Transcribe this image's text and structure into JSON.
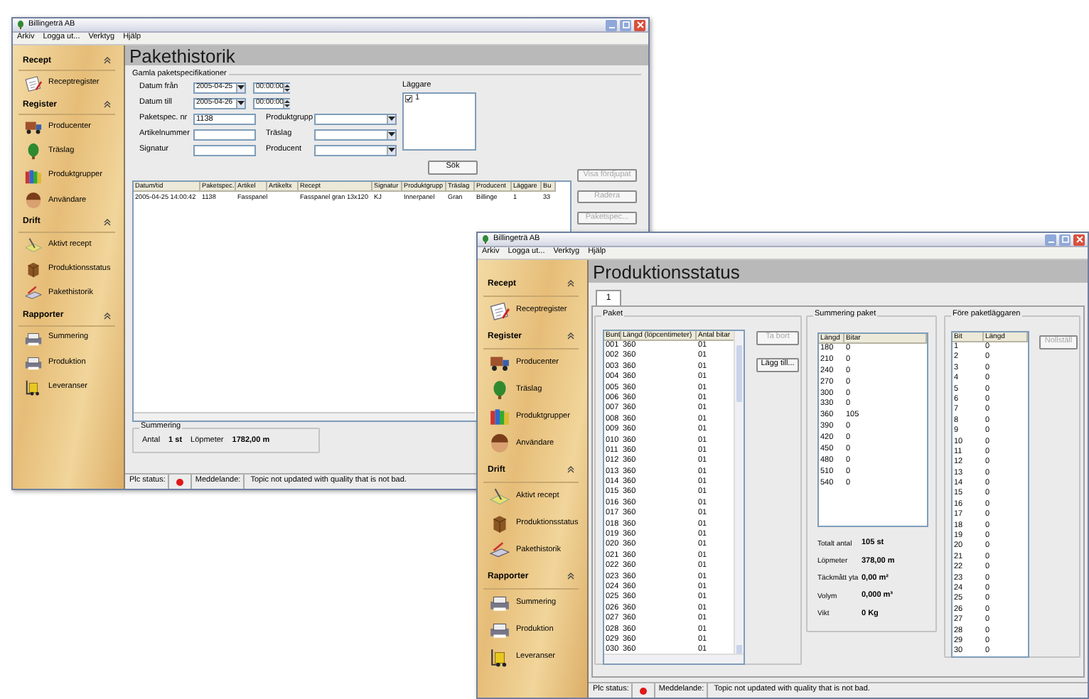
{
  "pakethistorik_window": {
    "title": "Billingeträ AB",
    "menu": [
      "Arkiv",
      "Logga ut...",
      "Verktyg",
      "Hjälp"
    ],
    "sidebar": [
      {
        "title": "Recept",
        "items": [
          "Receptregister"
        ]
      },
      {
        "title": "Register",
        "items": [
          "Producenter",
          "Träslag",
          "Produktgrupper",
          "Användare"
        ]
      },
      {
        "title": "Drift",
        "items": [
          "Aktivt recept",
          "Produktionsstatus",
          "Pakethistorik"
        ]
      },
      {
        "title": "Rapporter",
        "items": [
          "Summering",
          "Produktion",
          "Leveranser"
        ]
      }
    ],
    "heading": "Pakethistorik",
    "filter": {
      "title": "Gamla paketspecifikationer",
      "date_rows": [
        {
          "label": "Datum från",
          "date": "2005-04-25",
          "time": "00:00:00"
        },
        {
          "label": "Datum till",
          "date": "2005-04-26",
          "time": "00:00:00"
        }
      ],
      "field_rows": [
        {
          "label": "Paketspec. nr",
          "value": "1138",
          "combo_label": "Produktgrupp"
        },
        {
          "label": "Artikelnummer",
          "combo_label": "Träslag"
        },
        {
          "label": "Signatur",
          "combo_label": "Producent"
        }
      ],
      "laggare": {
        "label": "Läggare",
        "items": [
          {
            "label": "1",
            "checked": true
          }
        ]
      },
      "search_button": "Sök"
    },
    "table": {
      "columns": [
        "Datum/tid",
        "Paketspec.",
        "Artikel",
        "Artikeltx",
        "Recept",
        "Signatur",
        "Produktgrupp",
        "Träslag",
        "Producent",
        "Läggare",
        "Bu"
      ],
      "rows": [
        [
          "2005-04-25 14:00:42",
          "1138",
          "Fasspanel",
          null,
          "Fasspanel gran 13x120",
          "KJ",
          "Innerpanel",
          "Gran",
          "Billinge",
          "1",
          "33"
        ]
      ]
    },
    "side_buttons": [
      {
        "label": "Visa fördjupat",
        "disabled": true
      },
      {
        "label": "Radera",
        "disabled": true
      },
      {
        "label": "Paketspec...",
        "disabled": true
      }
    ],
    "summary": {
      "title": "Summering",
      "items": [
        {
          "label": "Antal",
          "value": "1 st"
        },
        {
          "label": "Löpmeter",
          "value": "1782,00 m"
        }
      ]
    },
    "status_bar": {
      "plc_label": "Plc status:",
      "plc_ok": false,
      "message_label": "Meddelande:",
      "message": "Topic not updated with quality that is not bad."
    }
  },
  "produktionsstatus_window": {
    "title": "Billingeträ AB",
    "menu": [
      "Arkiv",
      "Logga ut...",
      "Verktyg",
      "Hjälp"
    ],
    "sidebar": [
      {
        "title": "Recept",
        "items": [
          "Receptregister"
        ]
      },
      {
        "title": "Register",
        "items": [
          "Producenter",
          "Träslag",
          "Produktgrupper",
          "Användare"
        ]
      },
      {
        "title": "Drift",
        "items": [
          "Aktivt recept",
          "Produktionsstatus",
          "Pakethistorik"
        ]
      },
      {
        "title": "Rapporter",
        "items": [
          "Summering",
          "Produktion",
          "Leveranser"
        ]
      }
    ],
    "heading": "Produktionsstatus",
    "tabs": [
      {
        "label": "1",
        "selected": true
      }
    ],
    "paket": {
      "title": "Paket",
      "columns": [
        "Bunt",
        "Längd (löpcentimeter)",
        "Antal bitar"
      ],
      "rows": [
        [
          "001",
          "360",
          "01"
        ],
        [
          "002",
          "360",
          "01"
        ],
        [
          "003",
          "360",
          "01"
        ],
        [
          "004",
          "360",
          "01"
        ],
        [
          "005",
          "360",
          "01"
        ],
        [
          "006",
          "360",
          "01"
        ],
        [
          "007",
          "360",
          "01"
        ],
        [
          "008",
          "360",
          "01"
        ],
        [
          "009",
          "360",
          "01"
        ],
        [
          "010",
          "360",
          "01"
        ],
        [
          "011",
          "360",
          "01"
        ],
        [
          "012",
          "360",
          "01"
        ],
        [
          "013",
          "360",
          "01"
        ],
        [
          "014",
          "360",
          "01"
        ],
        [
          "015",
          "360",
          "01"
        ],
        [
          "016",
          "360",
          "01"
        ],
        [
          "017",
          "360",
          "01"
        ],
        [
          "018",
          "360",
          "01"
        ],
        [
          "019",
          "360",
          "01"
        ],
        [
          "020",
          "360",
          "01"
        ],
        [
          "021",
          "360",
          "01"
        ],
        [
          "022",
          "360",
          "01"
        ],
        [
          "023",
          "360",
          "01"
        ],
        [
          "024",
          "360",
          "01"
        ],
        [
          "025",
          "360",
          "01"
        ],
        [
          "026",
          "360",
          "01"
        ],
        [
          "027",
          "360",
          "01"
        ],
        [
          "028",
          "360",
          "01"
        ],
        [
          "029",
          "360",
          "01"
        ],
        [
          "030",
          "360",
          "01"
        ]
      ],
      "buttons": [
        {
          "label": "Ta bort",
          "disabled": true
        },
        {
          "label": "Lägg till...",
          "disabled": false
        }
      ]
    },
    "summering_paket": {
      "title": "Summering paket",
      "columns": [
        "Längd",
        "Bitar"
      ],
      "rows": [
        [
          "180",
          "0"
        ],
        [
          "210",
          "0"
        ],
        [
          "240",
          "0"
        ],
        [
          "270",
          "0"
        ],
        [
          "300",
          "0"
        ],
        [
          "330",
          "0"
        ],
        [
          "360",
          "105"
        ],
        [
          "390",
          "0"
        ],
        [
          "420",
          "0"
        ],
        [
          "450",
          "0"
        ],
        [
          "480",
          "0"
        ],
        [
          "510",
          "0"
        ],
        [
          "540",
          "0"
        ]
      ],
      "totals": [
        {
          "label": "Totalt antal",
          "value": "105 st"
        },
        {
          "label": "Löpmeter",
          "value": "378,00 m"
        },
        {
          "label": "Täckmått yta",
          "value": "0,00 m²"
        },
        {
          "label": "Volym",
          "value": "0,000 m³"
        },
        {
          "label": "Vikt",
          "value": "0 Kg"
        }
      ]
    },
    "fore_paketlaggaren": {
      "title": "Före paketläggaren",
      "columns": [
        "Bit",
        "Längd"
      ],
      "rows": [
        [
          "1",
          "0"
        ],
        [
          "2",
          "0"
        ],
        [
          "3",
          "0"
        ],
        [
          "4",
          "0"
        ],
        [
          "5",
          "0"
        ],
        [
          "6",
          "0"
        ],
        [
          "7",
          "0"
        ],
        [
          "8",
          "0"
        ],
        [
          "9",
          "0"
        ],
        [
          "10",
          "0"
        ],
        [
          "11",
          "0"
        ],
        [
          "12",
          "0"
        ],
        [
          "13",
          "0"
        ],
        [
          "14",
          "0"
        ],
        [
          "15",
          "0"
        ],
        [
          "16",
          "0"
        ],
        [
          "17",
          "0"
        ],
        [
          "18",
          "0"
        ],
        [
          "19",
          "0"
        ],
        [
          "20",
          "0"
        ],
        [
          "21",
          "0"
        ],
        [
          "22",
          "0"
        ],
        [
          "23",
          "0"
        ],
        [
          "24",
          "0"
        ],
        [
          "25",
          "0"
        ],
        [
          "26",
          "0"
        ],
        [
          "27",
          "0"
        ],
        [
          "28",
          "0"
        ],
        [
          "29",
          "0"
        ],
        [
          "30",
          "0"
        ]
      ],
      "button": {
        "label": "Nollställ",
        "disabled": true
      }
    },
    "status_bar": {
      "plc_label": "Plc status:",
      "plc_ok": false,
      "message_label": "Meddelande:",
      "message": "Topic not updated with quality that is not bad."
    }
  }
}
